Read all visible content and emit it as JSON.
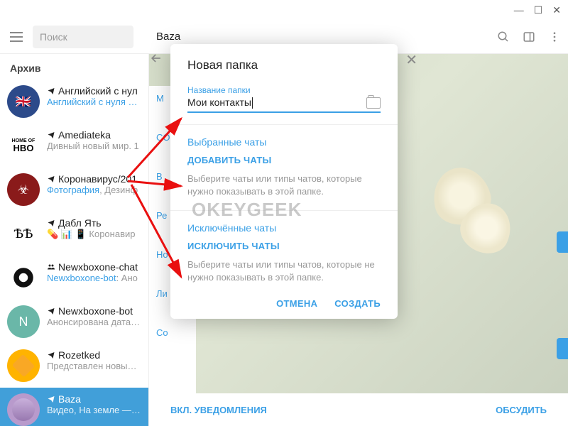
{
  "titlebar": {
    "min": "—",
    "max": "☐",
    "close": "✕"
  },
  "header": {
    "search_placeholder": "Поиск",
    "chat_name": "Baza"
  },
  "sidebar": {
    "archive": "Архив",
    "items": [
      {
        "name": "Английский с нул",
        "sub": "Английский с нуля – У",
        "icon": "channel",
        "avatar": "flag-uk"
      },
      {
        "name": "Amediateka",
        "sub": "Дивный новый мир. 1",
        "icon": "channel",
        "avatar": "hbo",
        "sub_gray": true
      },
      {
        "name": "Коронавирус/201",
        "sub_prefix": "Фотография",
        "sub_rest": ", Дезинф",
        "icon": "channel",
        "avatar": "bio"
      },
      {
        "name": "Дабл Ять",
        "sub": "💊 📊 📱 Коронавир",
        "icon": "channel",
        "avatar": "bb",
        "sub_gray": true
      },
      {
        "name": "Newxboxone-chat",
        "sub_prefix": "Newxboxone-bot",
        "sub_rest": ": Ано",
        "icon": "group",
        "avatar": "xbox"
      },
      {
        "name": "Newxboxone-bot",
        "sub": "Анонсирована дата ко",
        "icon": "channel",
        "avatar": "n",
        "sub_gray": true
      },
      {
        "name": "Rozetked",
        "sub": "Представлен новый M",
        "icon": "channel",
        "avatar": "roz",
        "sub_gray": true
      },
      {
        "name": "Baza",
        "sub": "Видео, На земле — мощная",
        "icon": "channel",
        "avatar": "baza",
        "active": true
      }
    ]
  },
  "content": {
    "strip": [
      "М",
      "CO",
      "В",
      "Ре",
      "Но",
      "Ли",
      "Co"
    ],
    "notif": "ВКЛ. УВЕДОМЛЕНИЯ",
    "discuss": "ОБСУДИТЬ"
  },
  "modal": {
    "title": "Новая папка",
    "field_label": "Название папки",
    "field_value": "Мои контакты",
    "included_title": "Выбранные чаты",
    "add_chats": "ДОБАВИТЬ ЧАТЫ",
    "included_desc": "Выберите чаты или типы чатов, которые нужно показывать в этой папке.",
    "excluded_title": "Исключённые чаты",
    "exclude_chats": "ИСКЛЮЧИТЬ ЧАТЫ",
    "excluded_desc": "Выберите чаты или типы чатов, которые не нужно показывать в этой папке.",
    "cancel": "ОТМЕНА",
    "create": "СОЗДАТЬ"
  },
  "watermark": "OKEYGEEK"
}
